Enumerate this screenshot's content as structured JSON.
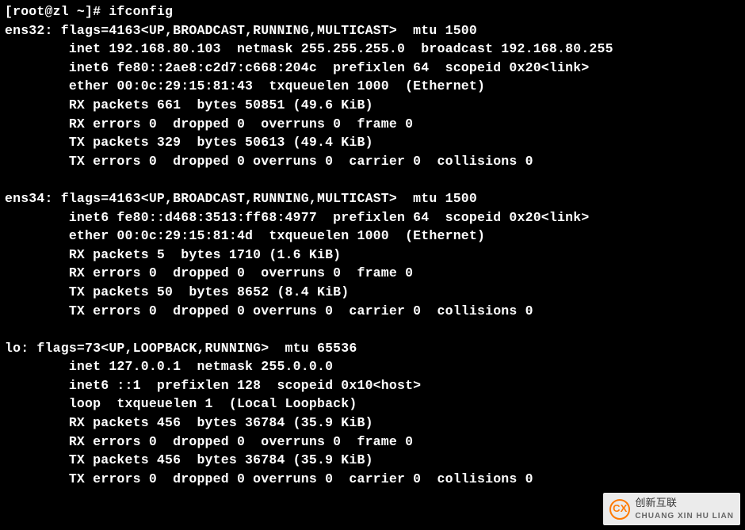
{
  "prompt": "[root@zl ~]# ifconfig",
  "interfaces": [
    {
      "name": "ens32",
      "header": "ens32: flags=4163<UP,BROADCAST,RUNNING,MULTICAST>  mtu 1500",
      "lines": [
        "        inet 192.168.80.103  netmask 255.255.255.0  broadcast 192.168.80.255",
        "        inet6 fe80::2ae8:c2d7:c668:204c  prefixlen 64  scopeid 0x20<link>",
        "        ether 00:0c:29:15:81:43  txqueuelen 1000  (Ethernet)",
        "        RX packets 661  bytes 50851 (49.6 KiB)",
        "        RX errors 0  dropped 0  overruns 0  frame 0",
        "        TX packets 329  bytes 50613 (49.4 KiB)",
        "        TX errors 0  dropped 0 overruns 0  carrier 0  collisions 0"
      ]
    },
    {
      "name": "ens34",
      "header": "ens34: flags=4163<UP,BROADCAST,RUNNING,MULTICAST>  mtu 1500",
      "lines": [
        "        inet6 fe80::d468:3513:ff68:4977  prefixlen 64  scopeid 0x20<link>",
        "        ether 00:0c:29:15:81:4d  txqueuelen 1000  (Ethernet)",
        "        RX packets 5  bytes 1710 (1.6 KiB)",
        "        RX errors 0  dropped 0  overruns 0  frame 0",
        "        TX packets 50  bytes 8652 (8.4 KiB)",
        "        TX errors 0  dropped 0 overruns 0  carrier 0  collisions 0"
      ]
    },
    {
      "name": "lo",
      "header": "lo: flags=73<UP,LOOPBACK,RUNNING>  mtu 65536",
      "lines": [
        "        inet 127.0.0.1  netmask 255.0.0.0",
        "        inet6 ::1  prefixlen 128  scopeid 0x10<host>",
        "        loop  txqueuelen 1  (Local Loopback)",
        "        RX packets 456  bytes 36784 (35.9 KiB)",
        "        RX errors 0  dropped 0  overruns 0  frame 0",
        "        TX packets 456  bytes 36784 (35.9 KiB)",
        "        TX errors 0  dropped 0 overruns 0  carrier 0  collisions 0"
      ]
    }
  ],
  "watermark": {
    "logo_text": "CX",
    "label": "创新互联",
    "sub": "CHUANG XIN HU LIAN"
  }
}
